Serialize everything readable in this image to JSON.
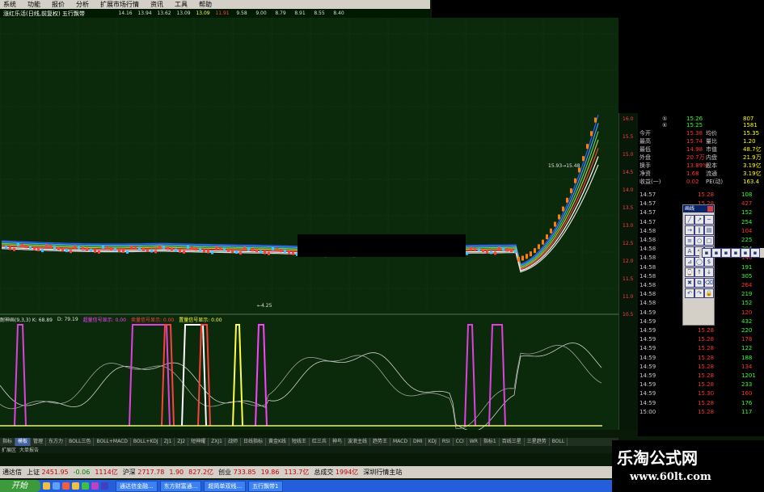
{
  "menu": [
    "系统",
    "功能",
    "报价",
    "分析",
    "扩展市场行情",
    "资讯",
    "工具",
    "帮助"
  ],
  "ohlc_bar": {
    "title": "涨红乐活(日线,前复权) 五行飘带",
    "values": [
      "14.16",
      "13.94",
      "13.62",
      "13.09",
      "13.09",
      "11.91",
      "9.58",
      "9.00",
      "8.79",
      "8.91",
      "8.55",
      "8.40"
    ]
  },
  "chart_annotations": {
    "high_tag": "15.93→15.48",
    "low_tag": "←4.25"
  },
  "price_axis": [
    "16.0",
    "15.5",
    "15.0",
    "14.5",
    "14.0",
    "13.5",
    "13.0",
    "12.5",
    "12.0",
    "11.5",
    "11.0",
    "10.5"
  ],
  "quote": {
    "top_rows": [
      {
        "a": "⑤",
        "b": "15.26",
        "c": "807"
      },
      {
        "a": "⑥",
        "b": "15.25",
        "c": "1581"
      }
    ],
    "stats": [
      {
        "l1": "今开",
        "v1": "15.38",
        "l2": "均价",
        "v2": "15.35"
      },
      {
        "l1": "最高",
        "v1": "15.74",
        "l2": "量比",
        "v2": "1.20"
      },
      {
        "l1": "最低",
        "v1": "14.98",
        "l2": "市值",
        "v2": "48.7亿"
      },
      {
        "l1": "外盘",
        "v1": "20.7万",
        "l2": "内盘",
        "v2": "21.9万"
      },
      {
        "l1": "换手",
        "v1": "13.89%",
        "l2": "股本",
        "v2": "3.19亿"
      },
      {
        "l1": "净资",
        "v1": "1.68",
        "l2": "流通",
        "v2": "3.19亿"
      },
      {
        "l1": "收益(一)",
        "v1": "0.02",
        "l2": "PE(动)",
        "v2": "163.4"
      }
    ],
    "ticks": [
      {
        "t": "14:57",
        "p": "15.28",
        "v": "108"
      },
      {
        "t": "14:57",
        "p": "15.28",
        "v": "427"
      },
      {
        "t": "14:57",
        "p": "15.28",
        "v": "152"
      },
      {
        "t": "14:57",
        "p": "15.27",
        "v": "254"
      },
      {
        "t": "14:58",
        "p": "15.27",
        "v": "104"
      },
      {
        "t": "14:58",
        "p": "15.28",
        "v": "225"
      },
      {
        "t": "14:58",
        "p": "15.28",
        "v": "304"
      },
      {
        "t": "14:58",
        "p": "15.28",
        "v": "146"
      },
      {
        "t": "14:58",
        "p": "15.27",
        "v": "191"
      },
      {
        "t": "14:58",
        "p": "15.28",
        "v": "305"
      },
      {
        "t": "14:58",
        "p": "15.27",
        "v": "264"
      },
      {
        "t": "14:58",
        "p": "15.28",
        "v": "219"
      },
      {
        "t": "14:58",
        "p": "15.29",
        "v": "152"
      },
      {
        "t": "14:59",
        "p": "15.29",
        "v": "120"
      },
      {
        "t": "14:59",
        "p": "15.28",
        "v": "432"
      },
      {
        "t": "14:59",
        "p": "15.28",
        "v": "220"
      },
      {
        "t": "14:59",
        "p": "15.28",
        "v": "178"
      },
      {
        "t": "14:59",
        "p": "15.28",
        "v": "122"
      },
      {
        "t": "14:59",
        "p": "15.28",
        "v": "188"
      },
      {
        "t": "14:59",
        "p": "15.28",
        "v": "134"
      },
      {
        "t": "14:59",
        "p": "15.28",
        "v": "1201"
      },
      {
        "t": "14:59",
        "p": "15.28",
        "v": "233"
      },
      {
        "t": "14:59",
        "p": "15.30",
        "v": "160"
      },
      {
        "t": "14:59",
        "p": "15.28",
        "v": "176"
      },
      {
        "t": "15:00",
        "p": "15.28",
        "v": "117"
      }
    ]
  },
  "toolbox": {
    "title": "画线",
    "icons": [
      "line",
      "ray",
      "segment",
      "arrow",
      "parallel",
      "channel",
      "fib",
      "circle",
      "rect",
      "text",
      "cycle",
      "gann",
      "speed",
      "ellipse",
      "price",
      "time",
      "up",
      "down",
      "del",
      "copy",
      "erase",
      "undo",
      "redo",
      "lock"
    ]
  },
  "sub_chart": {
    "label": "耐神画(9,3,3) K: 68.89",
    "d": "D: 79.19",
    "series": [
      "超量信号显示: 0.00",
      "卖量信号显示: 0.00",
      "置量信号显示: 0.00"
    ]
  },
  "tabs": [
    "指标",
    "模板",
    "管理",
    "东方力",
    "BOLL三色",
    "BOLL+MACD",
    "BOLL+KDJ",
    "ZJ1",
    "ZJ2",
    "短神耀",
    "ZXJ1",
    "战师",
    "日线指标",
    "黄金K线",
    "短线王",
    "红三兵",
    "神鸟",
    "波浪主线",
    "趋势王",
    "MACD",
    "DMI",
    "KDJ",
    "RSI",
    "CCI",
    "WR",
    "指标1",
    "百线三星",
    "三星趋势",
    "BOLL"
  ],
  "tabs2": [
    "扩展区",
    "大单报告"
  ],
  "status": [
    {
      "label": "通达信",
      "value": ""
    },
    {
      "label": "上证",
      "value": "2451.95"
    },
    {
      "label": "",
      "value": "-0.06"
    },
    {
      "label": "",
      "value": "1114亿"
    },
    {
      "label": "沪深",
      "value": "2717.78"
    },
    {
      "label": "",
      "value": "1.90"
    },
    {
      "label": "",
      "value": "827.2亿"
    },
    {
      "label": "创业",
      "value": "733.85"
    },
    {
      "label": "",
      "value": "19.86"
    },
    {
      "label": "",
      "value": "113.7亿"
    },
    {
      "label": "总成交",
      "value": "1994亿"
    },
    {
      "label": "深圳行情主站",
      "value": ""
    }
  ],
  "taskbar": {
    "start": "开始",
    "tasks": [
      "通达信金融...",
      "东方财富通...",
      "超简单双线...",
      "五行飘带1"
    ]
  },
  "watermark": {
    "line1": "乐淘公式网",
    "line2": "www.60lt.com"
  }
}
